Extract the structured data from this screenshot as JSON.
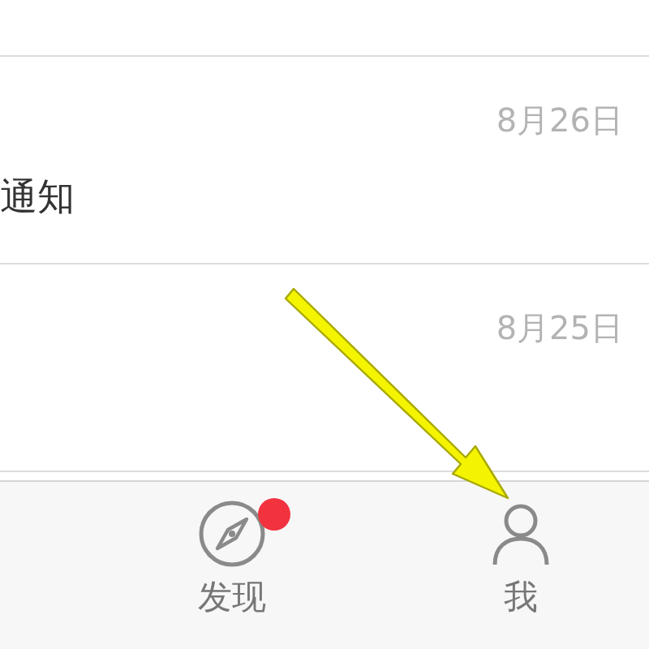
{
  "messages": [
    {
      "date": "8月26日",
      "text": "通知"
    },
    {
      "date": "8月25日"
    }
  ],
  "tab_bar": [
    {
      "kind": "compass",
      "label": "发现",
      "badge": true
    },
    {
      "kind": "person",
      "label": "我",
      "badge": false
    }
  ],
  "annotation": {
    "kind": "arrow"
  }
}
